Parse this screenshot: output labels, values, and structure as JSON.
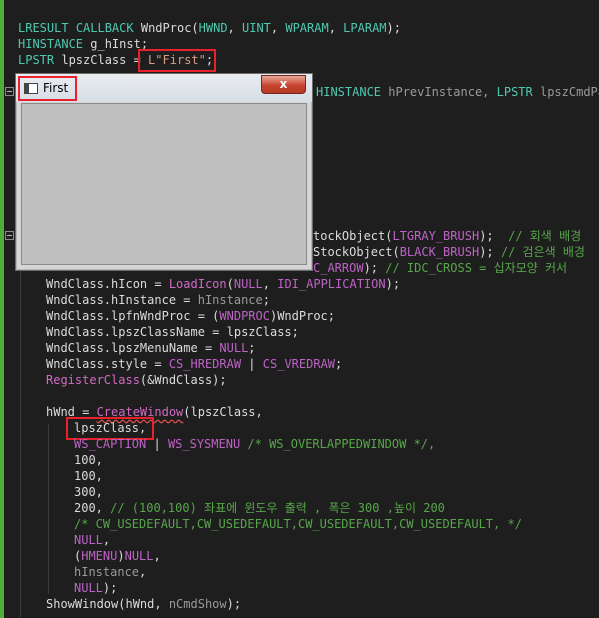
{
  "code": {
    "l1": {
      "t1": "LRESULT",
      "t2": "CALLBACK",
      "t3": "WndProc(",
      "t4": "HWND",
      "t5": ", ",
      "t6": "UINT",
      "t7": ", ",
      "t8": "WPARAM",
      "t9": ", ",
      "t10": "LPARAM",
      "t11": ");"
    },
    "l2": {
      "t1": "HINSTANCE",
      "t2": " g_hInst;"
    },
    "l3": {
      "t1": "LPSTR",
      "t2": " lpszClass = ",
      "t3": "L\"First\"",
      "t4": ";"
    },
    "l4": {
      "t1": "HINSTANCE",
      "t2": " hPrevInstance, ",
      "t3": "LPSTR",
      "t4": " lpszCmdPar"
    },
    "l5": {
      "t1": "tockObject(",
      "t2": "LTGRAY_BRUSH",
      "t3": ");",
      "t4": "  // 회색 배경"
    },
    "l6": {
      "t1": "StockObject(",
      "t2": "BLACK_BRUSH",
      "t3": ");",
      "t4": " // 검은색 배경"
    },
    "l7": {
      "t1": "C_ARROW",
      "t2": ");",
      "t3": " // IDC_CROSS = 십자모양 커서"
    },
    "l8": {
      "t1": "WndClass.hIcon = ",
      "t2": "LoadIcon",
      "t3": "(",
      "t4": "NULL",
      ",t5": "",
      "t5b": ", ",
      "t6": "IDI_APPLICATION",
      "t7": ");"
    },
    "l9": {
      "t1": "WndClass.hInstance = ",
      "t2": "hInstance",
      ",t3": "",
      "t3b": ";"
    },
    "l10": {
      "t1": "WndClass.lpfnWndProc = (",
      "t2": "WNDPROC",
      "t3": ")WndProc;"
    },
    "l11": {
      "t1": "WndClass.lpszClassName = lpszClass;"
    },
    "l12": {
      "t1": "WndClass.lpszMenuName = ",
      "t2": "NULL",
      "t3": ";"
    },
    "l13": {
      "t1": "WndClass.style = ",
      "t2": "CS_HREDRAW",
      "t3": " | ",
      "t4": "CS_VREDRAW",
      "t5": ";"
    },
    "l14": {
      "t1": "RegisterClass",
      "t2": "(&WndClass);"
    },
    "l15": {
      "t1": "hWnd = ",
      "t2": "CreateWindow",
      "t3": "(lpszClass,"
    },
    "l16": {
      "t1": "lpszClass,"
    },
    "l17": {
      "t1": "WS_CAPTION",
      "t2": " | ",
      "t3": "WS_SYSMENU",
      "t4": " /* WS_OVERLAPPEDWINDOW */,"
    },
    "l18": {
      "t1": "100,"
    },
    "l19": {
      "t1": "100,"
    },
    "l20": {
      "t1": "300,"
    },
    "l21": {
      "t1": "200,",
      "t2": " // (100,100) 좌표에 윈도우 출력 , 폭은 300 ,높이 200"
    },
    "l22": {
      "t1": "/* CW_USEDEFAULT,CW_USEDEFAULT,CW_USEDEFAULT,CW_USEDEFAULT, */"
    },
    "l23": {
      "t1": "NULL",
      "t2": ","
    },
    "l24": {
      "t1": "(",
      "t2": "HMENU",
      "t3": ")",
      "t4": "NULL",
      "t5": ","
    },
    "l25": {
      "t1": "hInstance",
      "t2": ","
    },
    "l26": {
      "t1": "NULL",
      "t2": ");"
    },
    "l27": {
      "t1": "ShowWindow(hWnd, ",
      "t2": "nCmdShow",
      "t3": ");"
    }
  },
  "window": {
    "title": "First",
    "close_label": "x"
  },
  "colors": {
    "editor_bg": "#1e1e1e",
    "highlight_box": "#e8212a",
    "gutter_marker": "#4fae3c"
  }
}
